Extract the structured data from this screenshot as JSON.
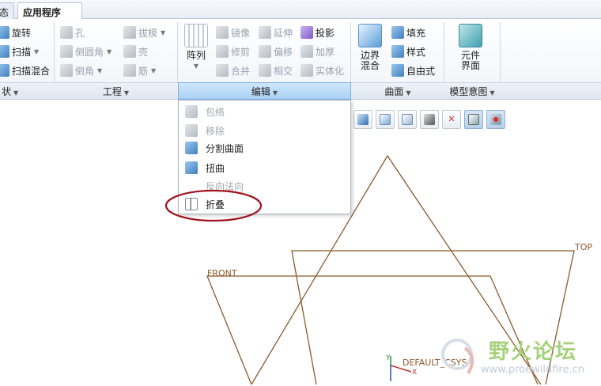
{
  "tabs": [
    {
      "label": "态"
    },
    {
      "label": "应用程序"
    }
  ],
  "ribbon": {
    "shapes": {
      "items": [
        {
          "label": "旋转",
          "icon": "revolve-icon"
        },
        {
          "label": "扫描",
          "icon": "sweep-icon"
        },
        {
          "label": "扫描混合",
          "icon": "swept-blend-icon"
        }
      ],
      "group_label": "状"
    },
    "engineering": {
      "items": [
        {
          "label": "孔",
          "icon": "hole-icon"
        },
        {
          "label": "倒圆角",
          "icon": "round-icon"
        },
        {
          "label": "倒角",
          "icon": "chamfer-icon"
        },
        {
          "label": "拔模",
          "icon": "draft-icon"
        },
        {
          "label": "壳",
          "icon": "shell-icon"
        },
        {
          "label": "筋",
          "icon": "rib-icon"
        }
      ],
      "group_label": "工程"
    },
    "editing": {
      "pattern_label": "阵列",
      "items": [
        {
          "label": "镜像",
          "icon": "mirror-icon"
        },
        {
          "label": "修剪",
          "icon": "trim-icon"
        },
        {
          "label": "合并",
          "icon": "merge-icon"
        },
        {
          "label": "延伸",
          "icon": "extend-icon"
        },
        {
          "label": "偏移",
          "icon": "offset-icon"
        },
        {
          "label": "相交",
          "icon": "intersect-icon"
        },
        {
          "label": "投影",
          "icon": "project-icon"
        },
        {
          "label": "加厚",
          "icon": "thicken-icon"
        },
        {
          "label": "实体化",
          "icon": "solidify-icon"
        }
      ],
      "group_label": "编辑"
    },
    "surfaces": {
      "boundary_label": "边界\n混合",
      "items": [
        {
          "label": "填充",
          "icon": "fill-icon"
        },
        {
          "label": "样式",
          "icon": "style-icon"
        },
        {
          "label": "自由式",
          "icon": "freestyle-icon"
        }
      ],
      "group_label": "曲面"
    },
    "model_intent": {
      "component_label": "元件\n界面",
      "group_label": "模型意图"
    }
  },
  "edit_menu": {
    "items": [
      {
        "label": "包络",
        "enabled": false,
        "icon": "wrap-icon"
      },
      {
        "label": "移除",
        "enabled": false,
        "icon": "remove-icon"
      },
      {
        "label": "分割曲面",
        "enabled": true,
        "icon": "split-surface-icon"
      },
      {
        "label": "扭曲",
        "enabled": true,
        "icon": "warp-icon"
      },
      {
        "label": "反向法向",
        "enabled": false,
        "icon": "flip-normal-icon"
      },
      {
        "label": "折叠",
        "enabled": true,
        "icon": "fold-icon"
      }
    ],
    "highlighted_item": "折叠",
    "highlight_color": "#a0121e"
  },
  "graphics_toolbar": {
    "buttons": [
      {
        "icon": "shading-icon",
        "on": false
      },
      {
        "icon": "view-normal-icon",
        "on": false
      },
      {
        "icon": "saved-views-icon",
        "on": false
      },
      {
        "icon": "display-style-icon",
        "on": false
      },
      {
        "icon": "datum-display-icon",
        "on": false
      },
      {
        "icon": "spin-center-icon",
        "on": true
      },
      {
        "icon": "annotation-display-icon",
        "on": true
      }
    ]
  },
  "canvas": {
    "datum_labels": {
      "top": "TOP",
      "front": "FRONT",
      "csys": "DEFAULT_CSYS"
    },
    "axis_labels": {
      "y": "Y",
      "x": "X"
    },
    "datum_color": "#8a5a2b"
  },
  "watermark": {
    "title": "野火论坛",
    "url": "www.proewildfire.cn"
  }
}
